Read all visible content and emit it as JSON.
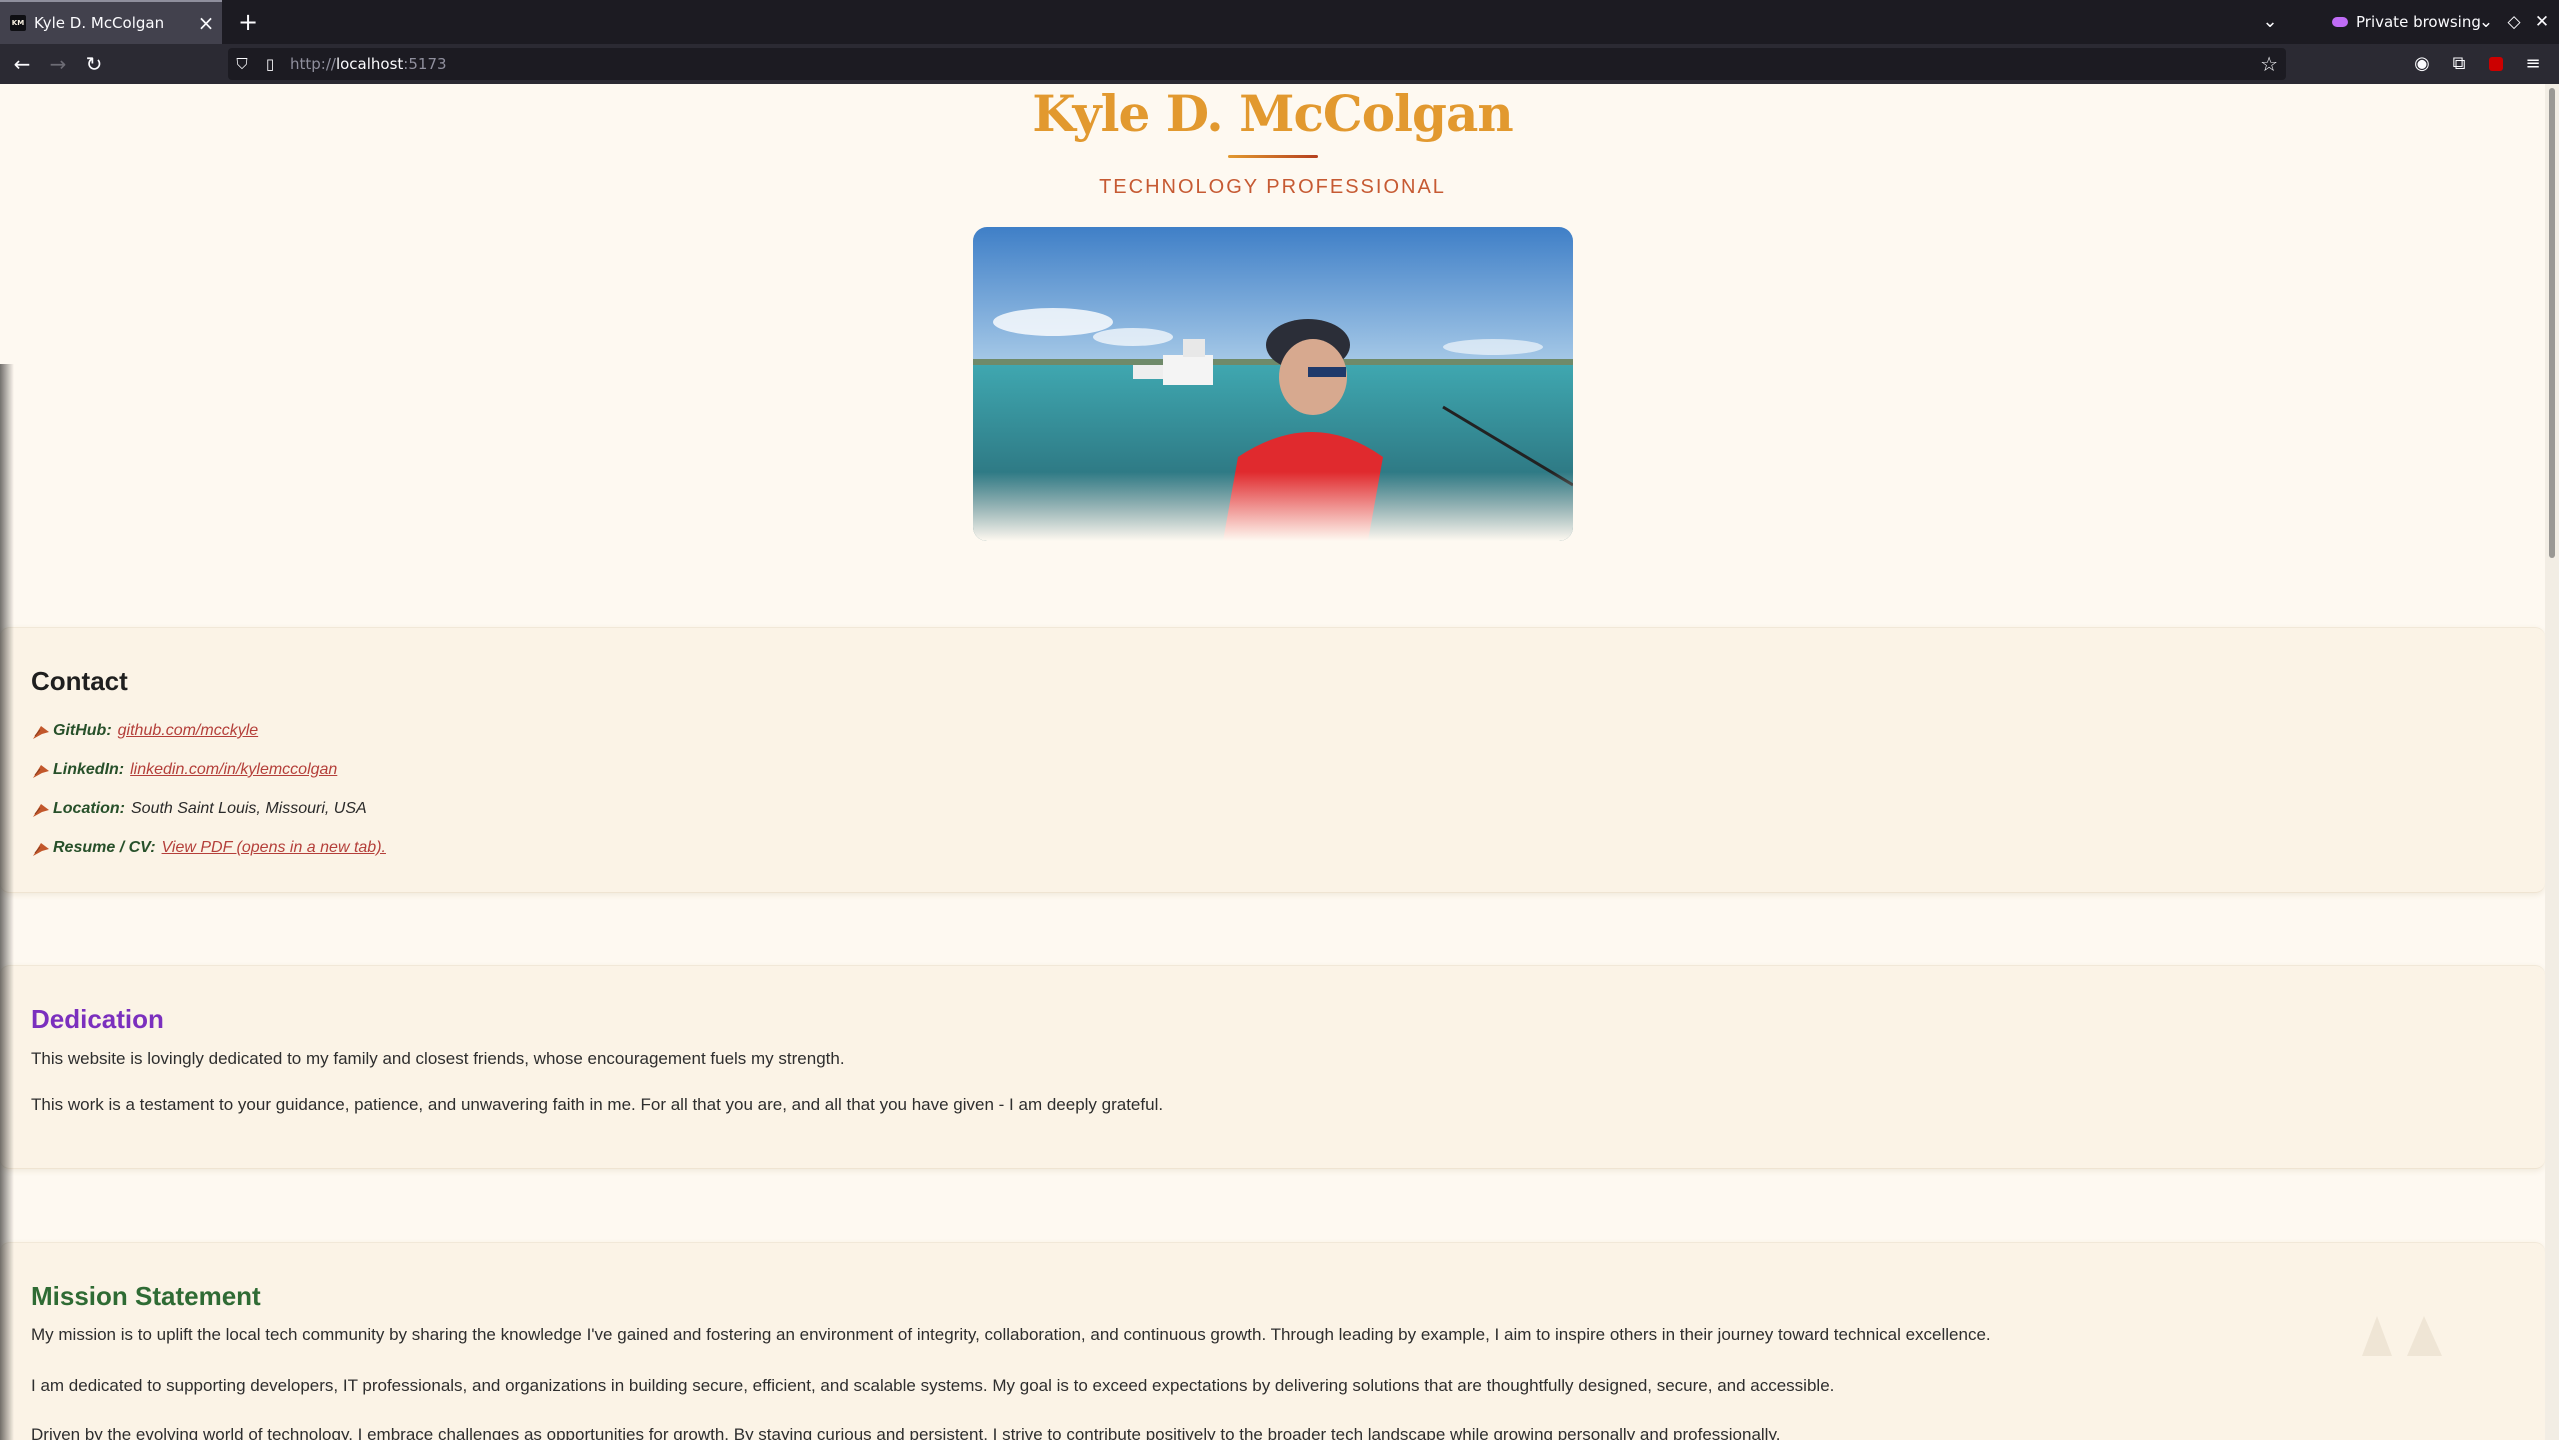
{
  "browser": {
    "tab_title": "Kyle D. McColgan",
    "tab_close": "×",
    "new_tab": "+",
    "tab_list": "⌄",
    "private_label": "Private browsing",
    "url_scheme": "http://",
    "url_host": "localhost",
    "url_port": ":5173",
    "favicon_text": "KM"
  },
  "header": {
    "name": "Kyle D. McColgan",
    "subtitle": "TECHNOLOGY PROFESSIONAL"
  },
  "contact": {
    "title": "Contact",
    "items": [
      {
        "label": "GitHub:",
        "value": "github.com/mcckyle",
        "link": true
      },
      {
        "label": "LinkedIn:",
        "value": "linkedin.com/in/kylemccolgan",
        "link": true
      },
      {
        "label": "Location:",
        "value": "South Saint Louis, Missouri, USA",
        "link": false
      },
      {
        "label": "Resume / CV:",
        "value": "View PDF (opens in a new tab).",
        "link": true
      }
    ]
  },
  "dedication": {
    "title": "Dedication",
    "title_color": "#7b2fbe",
    "paragraphs": [
      "This website is lovingly dedicated to my family and closest friends, whose encouragement fuels my strength.",
      "This work is a testament to your guidance, patience, and unwavering faith in me. For all that you are, and all that you have given - I am deeply grateful."
    ]
  },
  "mission": {
    "title": "Mission Statement",
    "title_color": "#2f6b34",
    "paragraphs": [
      "My mission is to uplift the local tech community by sharing the knowledge I've gained and fostering an environment of integrity, collaboration, and continuous growth. Through leading by example, I aim to inspire others in their journey toward technical excellence.",
      "I am dedicated to supporting developers, IT professionals, and organizations in building secure, efficient, and scalable systems. My goal is to exceed expectations by delivering solutions that are thoughtfully designed, secure, and accessible.",
      "Driven by the evolving world of technology, I embrace challenges as opportunities for growth. By staying curious and persistent, I strive to contribute positively to the broader tech landscape while growing personally and professionally."
    ]
  },
  "colors": {
    "name": "#e2992f",
    "subtitle": "#c65a33",
    "link": "#b43f3a",
    "contact_label": "#27502a",
    "page_bg": "#fef9f1",
    "card_bg": "#fbf3e6"
  }
}
